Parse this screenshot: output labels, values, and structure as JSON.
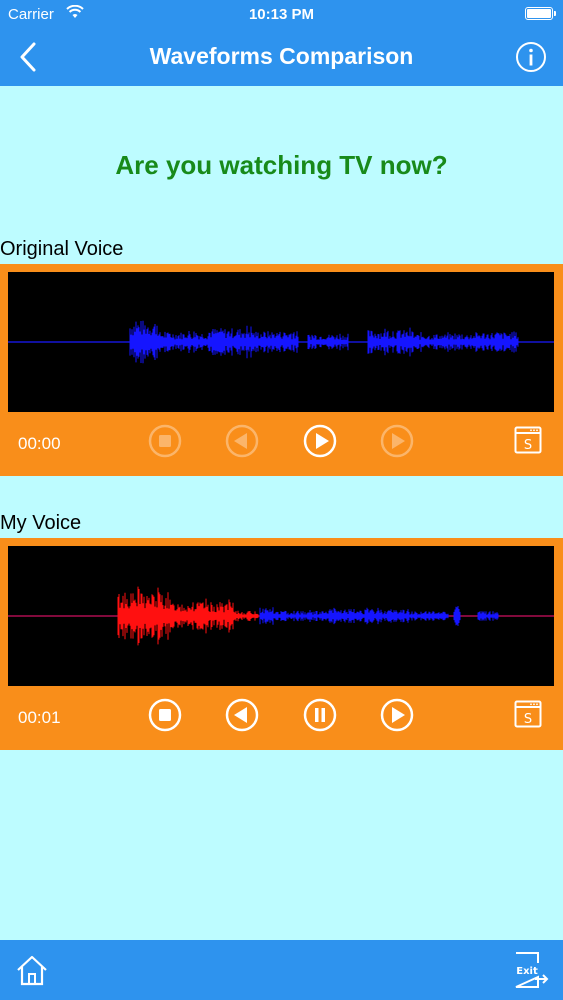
{
  "status_bar": {
    "carrier": "Carrier",
    "time": "10:13 PM"
  },
  "nav": {
    "title": "Waveforms Comparison",
    "back_icon": "chevron-left-icon",
    "info_icon": "info-icon"
  },
  "question": "Are you watching TV now?",
  "original": {
    "label": "Original Voice",
    "time": "00:00",
    "controls": {
      "stop_enabled": false,
      "rewind_enabled": false,
      "play_enabled": true,
      "forward_enabled": false
    }
  },
  "mine": {
    "label": "My Voice",
    "time": "00:01",
    "controls": {
      "stop_enabled": true,
      "rewind_enabled": true,
      "pause_enabled": true,
      "forward_enabled": true
    }
  },
  "bottom": {
    "home_icon": "home-icon",
    "exit_label": "Exit"
  },
  "colors": {
    "bar": "#2e93ee",
    "panel": "#f98e1a",
    "background": "#bdfcff",
    "question": "#188a1a",
    "wave_original": "#1515ff",
    "wave_recorded": "#ff1010"
  }
}
